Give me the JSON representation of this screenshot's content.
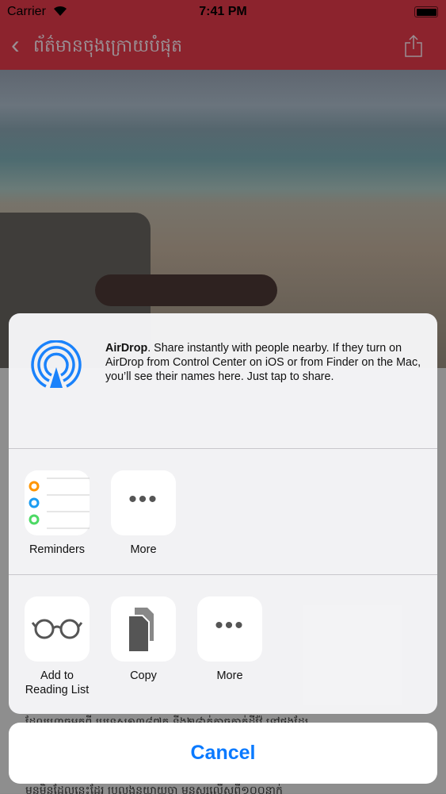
{
  "status_bar": {
    "carrier": "Carrier",
    "time": "7:41 PM"
  },
  "nav": {
    "back_title": "ព័ត៌មានចុងក្រោយបំផុត",
    "accent": "#8c232d"
  },
  "share_sheet": {
    "airdrop": {
      "title": "AirDrop",
      "text": ". Share instantly with people nearby. If they turn on AirDrop from Control Center on iOS or from Finder on the Mac, you’ll see their names here. Just tap to share."
    },
    "apps": [
      {
        "label": "Reminders",
        "icon": "reminders-icon"
      },
      {
        "label": "More",
        "icon": "more-icon"
      }
    ],
    "actions": [
      {
        "label": "Add to\nReading List",
        "icon": "glasses-icon"
      },
      {
        "label": "Copy",
        "icon": "copy-icon"
      },
      {
        "label": "More",
        "icon": "more-icon"
      }
    ],
    "cancel": "Cancel"
  }
}
